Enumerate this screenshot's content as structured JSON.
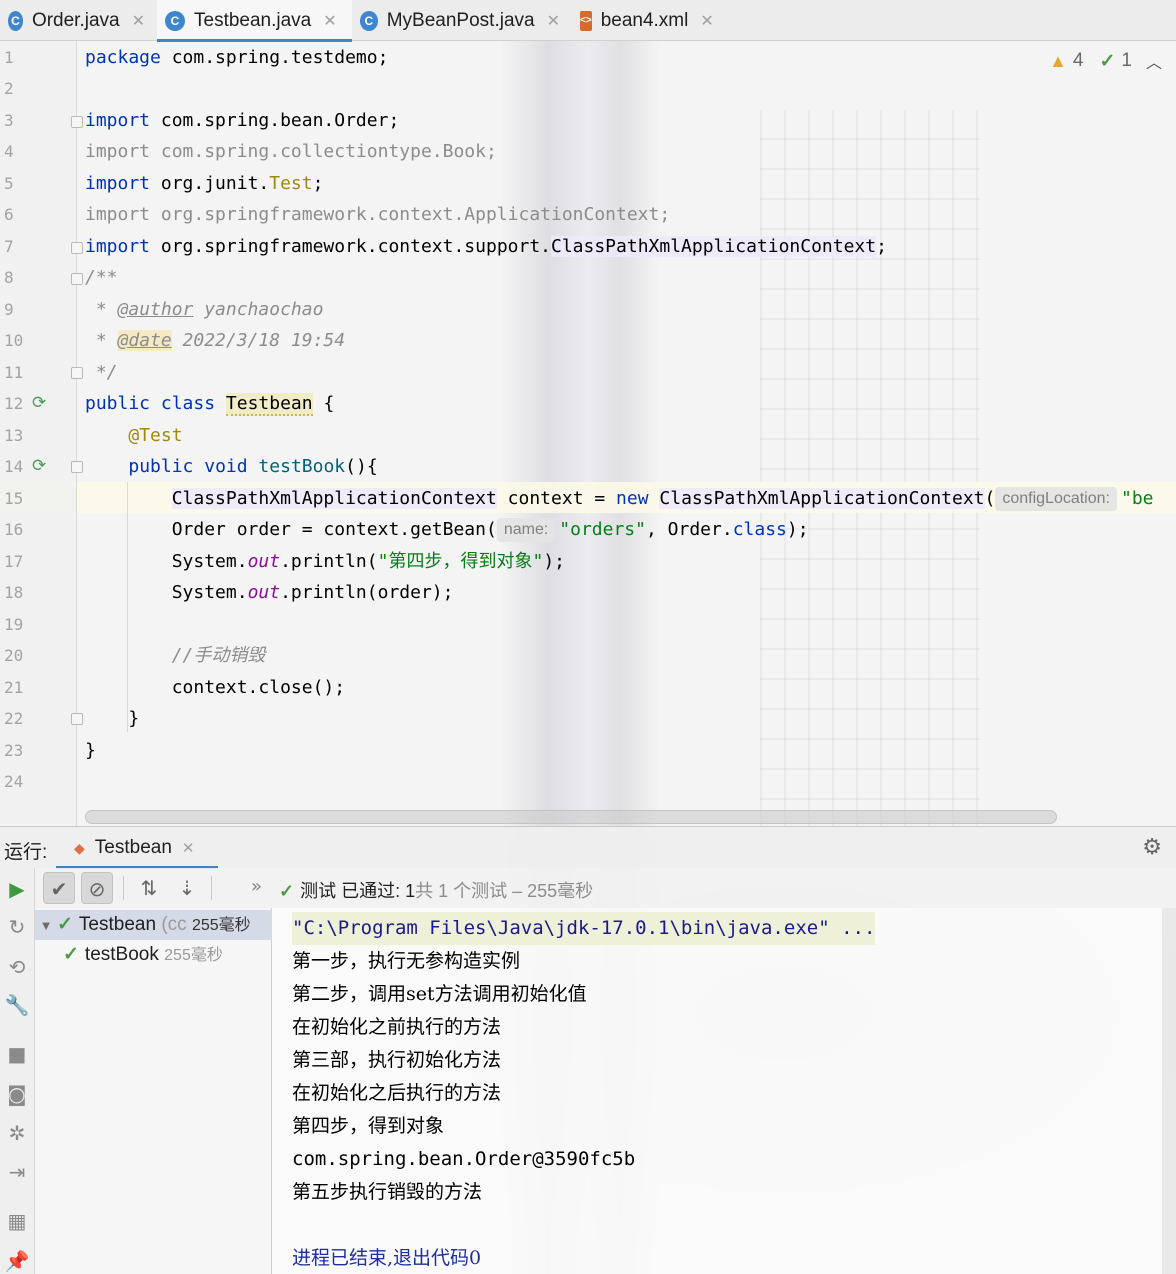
{
  "tabs": [
    {
      "label": "Order.java",
      "icon": "C"
    },
    {
      "label": "Testbean.java",
      "icon": "C"
    },
    {
      "label": "MyBeanPost.java",
      "icon": "C"
    },
    {
      "label": "bean4.xml",
      "icon": "xml"
    }
  ],
  "inspections": {
    "warnings": "4",
    "ok": "1"
  },
  "line_numbers": [
    "1",
    "2",
    "3",
    "4",
    "5",
    "6",
    "7",
    "8",
    "9",
    "10",
    "11",
    "12",
    "13",
    "14",
    "15",
    "16",
    "17",
    "18",
    "19",
    "20",
    "21",
    "22",
    "23",
    "24"
  ],
  "code": {
    "l1": {
      "kw": "package",
      "rest": " com.spring.testdemo;"
    },
    "l3": {
      "kw": "import",
      "rest": " com.spring.bean.Order;"
    },
    "l4": {
      "text": "import com.spring.collectiontype.Book;"
    },
    "l5": {
      "kw": "import",
      "rest": " org.junit.",
      "ann": "Test",
      "end": ";"
    },
    "l6": {
      "text": "import org.springframework.context.ApplicationContext;"
    },
    "l7": {
      "kw": "import",
      "rest": " org.springframework.context.support.",
      "cls": "ClassPathXmlApplicationContext",
      "end": ";"
    },
    "l8": {
      "text": "/**"
    },
    "l9": {
      "star": " * ",
      "tag": "@author",
      "rest": " yanchaochao"
    },
    "l10": {
      "star": " * ",
      "tag": "@date",
      "rest": " 2022/3/18 19:54"
    },
    "l11": {
      "text": " */"
    },
    "l12": {
      "kw1": "public",
      "kw2": "class",
      "name": "Testbean",
      "end": " {"
    },
    "l13": {
      "ann": "@Test"
    },
    "l14": {
      "kw1": "public",
      "kw2": "void",
      "name": " testBook",
      "end": "(){"
    },
    "l15": {
      "cls1": "ClassPathXmlApplicationContext",
      "mid": " context = ",
      "kw": "new",
      "cls2": "ClassPathXmlApplicationContext",
      "paren": "(",
      "hint": "configLocation:",
      "str": "\"be"
    },
    "l16": {
      "pre": "Order order = context.getBean(",
      "hint": "name:",
      "str": "\"orders\"",
      "mid": ", Order.",
      "kw": "class",
      "end": ");"
    },
    "l17": {
      "pre": "System.",
      "field": "out",
      "mid": ".println(",
      "str": "\"第四步，得到对象\"",
      "end": ");"
    },
    "l18": {
      "pre": "System.",
      "field": "out",
      "end": ".println(order);"
    },
    "l20": {
      "comment": "//手动销毁"
    },
    "l21": {
      "text": "context.close();"
    },
    "l22": {
      "text": "}"
    },
    "l23": {
      "text": "}"
    }
  },
  "run_panel": {
    "label": "运行:",
    "tab": "Testbean",
    "status_prefix": "测试 已通过: ",
    "status_count": "1",
    "status_rest": "共 1 个测试 – 255毫秒",
    "more": "»"
  },
  "tree": [
    {
      "name": "Testbean",
      "extra": " (cc",
      "time": "255毫秒"
    },
    {
      "name": "testBook",
      "time": "255毫秒"
    }
  ],
  "console": [
    "\"C:\\Program Files\\Java\\jdk-17.0.1\\bin\\java.exe\" ...",
    "第一步，执行无参构造实例",
    "第二步，调用set方法调用初始化值",
    "在初始化之前执行的方法",
    "第三部，执行初始化方法",
    "在初始化之后执行的方法",
    "第四步，得到对象",
    "com.spring.bean.Order@3590fc5b",
    "第五步执行销毁的方法",
    "",
    "进程已结束,退出代码0"
  ]
}
